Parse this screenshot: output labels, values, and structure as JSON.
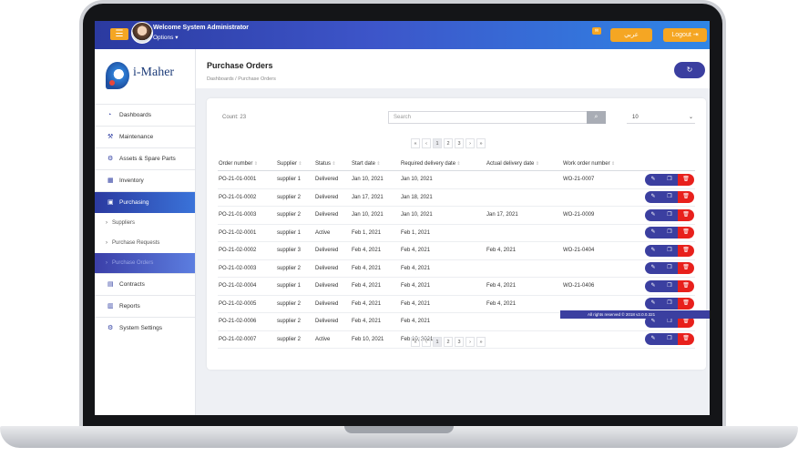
{
  "header": {
    "menu_icon": "hamburger-icon",
    "welcome": "Welcome System Administrator",
    "options": "Options ▾",
    "chat_icon": "chat-icon",
    "language_button": "عربي",
    "logout_button": "Logout ⇥"
  },
  "sidebar": {
    "logo_text": "i-Maher",
    "items": [
      {
        "label": "Dashboards",
        "icon": "dashboard-icon"
      },
      {
        "label": "Maintenance",
        "icon": "wrench-icon"
      },
      {
        "label": "Assets & Spare Parts",
        "icon": "box-icon"
      },
      {
        "label": "Inventory",
        "icon": "warehouse-icon"
      },
      {
        "label": "Purchasing",
        "icon": "cart-icon"
      },
      {
        "label": "Contracts",
        "icon": "contract-icon"
      },
      {
        "label": "Reports",
        "icon": "report-icon"
      },
      {
        "label": "System Settings",
        "icon": "gear-icon"
      }
    ],
    "sub_items": [
      {
        "label": "Suppliers"
      },
      {
        "label": "Purchase Requests"
      },
      {
        "label": "Purchase Orders"
      }
    ]
  },
  "page": {
    "title": "Purchase Orders",
    "breadcrumb": "Dashboards / Purchase Orders"
  },
  "list": {
    "count_label": "Count",
    "count_value": "23",
    "search_placeholder": "Search",
    "page_size": "10",
    "pager": [
      "«",
      "‹",
      "1",
      "2",
      "3",
      "›",
      "»"
    ],
    "columns": [
      "Order number",
      "Supplier",
      "Status",
      "Start date",
      "Required delivery date",
      "Actual delivery date",
      "Work order number"
    ],
    "rows": [
      [
        "PO-21-01-0001",
        "supplier 1",
        "Delivered",
        "Jan 10, 2021",
        "Jan 10, 2021",
        "",
        "WO-21-0007"
      ],
      [
        "PO-21-01-0002",
        "supplier 2",
        "Delivered",
        "Jan 17, 2021",
        "Jan 18, 2021",
        "",
        ""
      ],
      [
        "PO-21-01-0003",
        "supplier 2",
        "Delivered",
        "Jan 10, 2021",
        "Jan 10, 2021",
        "Jan 17, 2021",
        "WO-21-0009"
      ],
      [
        "PO-21-02-0001",
        "supplier 1",
        "Active",
        "Feb 1, 2021",
        "Feb 1, 2021",
        "",
        ""
      ],
      [
        "PO-21-02-0002",
        "supplier 3",
        "Delivered",
        "Feb 4, 2021",
        "Feb 4, 2021",
        "Feb 4, 2021",
        "WO-21-0404"
      ],
      [
        "PO-21-02-0003",
        "supplier 2",
        "Delivered",
        "Feb 4, 2021",
        "Feb 4, 2021",
        "",
        ""
      ],
      [
        "PO-21-02-0004",
        "supplier 1",
        "Delivered",
        "Feb 4, 2021",
        "Feb 4, 2021",
        "Feb 4, 2021",
        "WO-21-0406"
      ],
      [
        "PO-21-02-0005",
        "supplier 2",
        "Delivered",
        "Feb 4, 2021",
        "Feb 4, 2021",
        "Feb 4, 2021",
        ""
      ],
      [
        "PO-21-02-0006",
        "supplier 2",
        "Delivered",
        "Feb 4, 2021",
        "Feb 4, 2021",
        "",
        ""
      ],
      [
        "PO-21-02-0007",
        "supplier 2",
        "Active",
        "Feb 10, 2021",
        "Feb 10, 2021",
        "",
        ""
      ]
    ],
    "actions": {
      "edit": "✎",
      "copy": "❐",
      "delete": "🗑"
    }
  },
  "footer": {
    "text": "All rights reserved © 2018  v2.0.0.321"
  }
}
